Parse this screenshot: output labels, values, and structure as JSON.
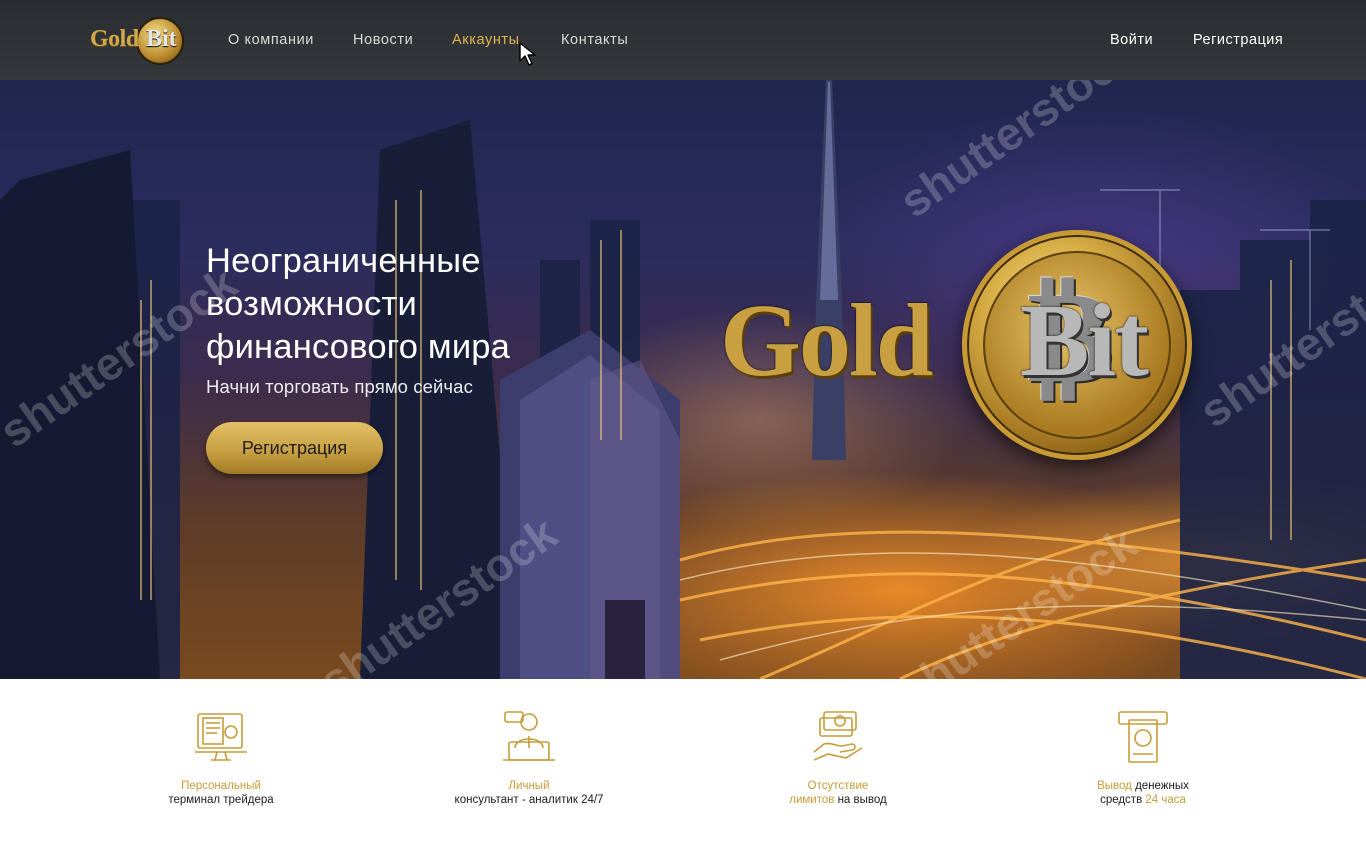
{
  "brand": {
    "logo_text_gold": "Gold",
    "logo_text_bit": "Bit",
    "accent_color": "#d4a94a"
  },
  "nav": {
    "links": [
      {
        "label": "О компании"
      },
      {
        "label": "Новости"
      },
      {
        "label": "Аккаунты",
        "active": true
      },
      {
        "label": "Контакты"
      }
    ],
    "login_label": "Войти",
    "register_label": "Регистрация"
  },
  "hero": {
    "title": "Неограниченные возможности финансового мира",
    "subtitle": "Начни торговать прямо сейчас",
    "cta_label": "Регистрация",
    "logo_gold": "Gold",
    "logo_bit": "Bit",
    "coin_symbol": "₿",
    "watermark": "shutterstock"
  },
  "features": [
    {
      "icon": "trader-terminal-icon",
      "line1_gold": "Персональный",
      "line2": "терминал трейдера"
    },
    {
      "icon": "consultant-icon",
      "line1_gold": "Личный",
      "line2": "консультант - аналитик 24/7"
    },
    {
      "icon": "no-limits-icon",
      "line1_gold": "Отсутствие",
      "line2_gold": "лимитов",
      "line2": " на вывод"
    },
    {
      "icon": "withdrawal-icon",
      "line1_gold": "Вывод",
      "line1_dark": " денежных",
      "line2": "средств ",
      "line2_gold": "24 часа"
    }
  ]
}
